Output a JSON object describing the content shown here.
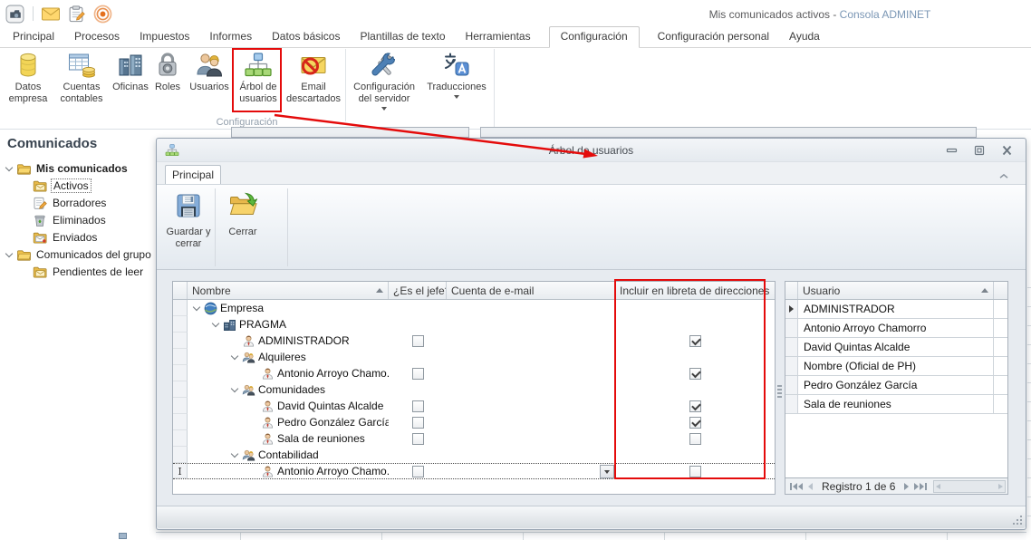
{
  "colors": {
    "annotation_red": "#e40b0b",
    "brand_blue": "#7b97b5",
    "node_green": "#a8d878",
    "node_blue": "#a6ccee"
  },
  "app": {
    "quick_access": [
      {
        "icon": "app-icon"
      },
      {
        "icon": "mail-icon"
      },
      {
        "icon": "tasks-icon"
      },
      {
        "icon": "broadcast-icon"
      }
    ],
    "title": {
      "left": "Mis comunicados activos -",
      "brand": "Consola ADMINET"
    },
    "tabs": [
      {
        "label": "Principal"
      },
      {
        "label": "Procesos"
      },
      {
        "label": "Impuestos"
      },
      {
        "label": "Informes"
      },
      {
        "label": "Datos básicos"
      },
      {
        "label": "Plantillas de texto"
      },
      {
        "label": "Herramientas"
      },
      {
        "label": "Configuración",
        "active": true
      },
      {
        "label": "Configuración personal"
      },
      {
        "label": "Ayuda"
      }
    ],
    "ribbon": {
      "group_label": "Configuración",
      "buttons": [
        {
          "label": "Datos empresa",
          "icon": "database-icon"
        },
        {
          "label": "Cuentas contables",
          "icon": "accounts-table-icon"
        },
        {
          "label": "Oficinas",
          "icon": "offices-icon"
        },
        {
          "label": "Roles",
          "icon": "lock-icon"
        },
        {
          "label": "Usuarios",
          "icon": "users-icon"
        },
        {
          "label": "Árbol de usuarios",
          "icon": "user-tree-icon",
          "highlighted": true
        },
        {
          "label": "Email descartados",
          "icon": "discarded-email-icon"
        },
        {
          "label": "Configuración del servidor",
          "icon": "server-tools-icon",
          "dropdown": true
        },
        {
          "label": "Traducciones",
          "icon": "translations-icon",
          "dropdown": true
        }
      ]
    }
  },
  "sidebar": {
    "title": "Comunicados",
    "items": [
      {
        "label": "Mis comunicados",
        "icon": "folder-icon",
        "level": 0,
        "bold": true,
        "expanded": true
      },
      {
        "label": "Activos",
        "icon": "mail-folder-icon",
        "level": 1,
        "selected": true
      },
      {
        "label": "Borradores",
        "icon": "drafts-icon",
        "level": 1
      },
      {
        "label": "Eliminados",
        "icon": "trash-icon",
        "level": 1
      },
      {
        "label": "Enviados",
        "icon": "sent-icon",
        "level": 1
      },
      {
        "label": "Comunicados del grupo",
        "icon": "folder-icon",
        "level": 0,
        "expanded": true
      },
      {
        "label": "Pendientes de leer",
        "icon": "mail-folder-icon",
        "level": 1
      }
    ]
  },
  "dialog": {
    "title": "Árbol de usuarios",
    "tab": "Principal",
    "toolbar": [
      {
        "label": "Guardar y cerrar",
        "icon": "save-icon"
      },
      {
        "label": "Cerrar",
        "icon": "close-folder-icon"
      }
    ],
    "tree_grid": {
      "columns": [
        {
          "label": "Nombre",
          "sorted": "asc"
        },
        {
          "label": "¿Es el jefe?"
        },
        {
          "label": "Cuenta de e-mail"
        },
        {
          "label": "Incluir en libreta de direcciones",
          "highlighted": true
        }
      ],
      "rows": [
        {
          "name": "Empresa",
          "icon": "globe-icon",
          "level": 0,
          "expanded": true
        },
        {
          "name": "PRAGMA",
          "icon": "company-icon",
          "level": 1,
          "expanded": true
        },
        {
          "name": "ADMINISTRADOR",
          "icon": "user-icon",
          "level": 2,
          "is_boss": false,
          "address_book": true
        },
        {
          "name": "Alquileres",
          "icon": "group-icon",
          "level": 2,
          "expanded": true
        },
        {
          "name": "Antonio Arroyo Chamo...",
          "icon": "user-icon",
          "level": 3,
          "is_boss": false,
          "address_book": true
        },
        {
          "name": "Comunidades",
          "icon": "group-icon",
          "level": 2,
          "expanded": true
        },
        {
          "name": "David Quintas Alcalde",
          "icon": "user-icon",
          "level": 3,
          "is_boss": false,
          "address_book": true
        },
        {
          "name": "Pedro González García",
          "icon": "user-icon",
          "level": 3,
          "is_boss": false,
          "address_book": true
        },
        {
          "name": "Sala de reuniones",
          "icon": "user-icon",
          "level": 3,
          "is_boss": false,
          "address_book": false
        },
        {
          "name": "Contabilidad",
          "icon": "group-icon",
          "level": 2,
          "expanded": true
        },
        {
          "name": "Antonio Arroyo Chamo...",
          "icon": "user-icon",
          "level": 3,
          "is_boss": false,
          "address_book": false,
          "editing": true
        }
      ]
    },
    "user_list": {
      "column": "Usuario",
      "sorted": "asc",
      "rows": [
        {
          "name": "ADMINISTRADOR",
          "current": true
        },
        {
          "name": "Antonio Arroyo Chamorro"
        },
        {
          "name": "David Quintas Alcalde"
        },
        {
          "name": "Nombre (Oficial de PH)"
        },
        {
          "name": "Pedro González García"
        },
        {
          "name": "Sala de reuniones"
        }
      ],
      "pager": {
        "label": "Registro 1 de 6"
      }
    }
  }
}
